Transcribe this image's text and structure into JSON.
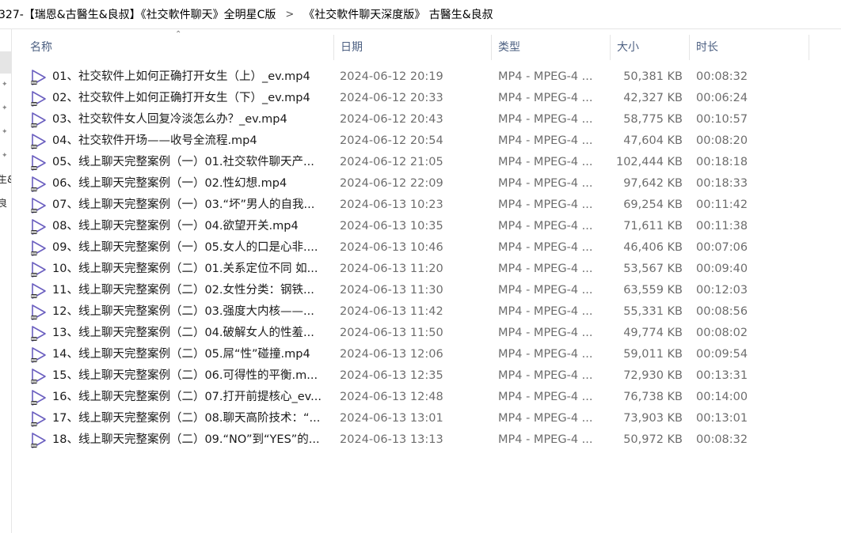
{
  "breadcrumb": {
    "items": [
      "327-【瑞恩&古醫生&良叔】《社交軟件聊天》全明星C版",
      "《社交軟件聊天深度版》 古醫生&良叔"
    ],
    "separator": ">"
  },
  "nav": {
    "fragments": [
      "生&",
      "良"
    ]
  },
  "columns": {
    "name": "名称",
    "date": "日期",
    "type": "类型",
    "size": "大小",
    "duration": "时长"
  },
  "icon_color": "#6b5fc0",
  "files": [
    {
      "name": "01、社交软件上如何正确打开女生（上）_ev.mp4",
      "date": "2024-06-12 20:19",
      "type": "MP4 - MPEG-4 ...",
      "size": "50,381 KB",
      "duration": "00:08:32"
    },
    {
      "name": "02、社交软件上如何正确打开女生（下）_ev.mp4",
      "date": "2024-06-12 20:33",
      "type": "MP4 - MPEG-4 ...",
      "size": "42,327 KB",
      "duration": "00:06:24"
    },
    {
      "name": "03、社交软件女人回复冷淡怎么办？_ev.mp4",
      "date": "2024-06-12 20:43",
      "type": "MP4 - MPEG-4 ...",
      "size": "58,775 KB",
      "duration": "00:10:57"
    },
    {
      "name": "04、社交软件开场——收号全流程.mp4",
      "date": "2024-06-12 20:54",
      "type": "MP4 - MPEG-4 ...",
      "size": "47,604 KB",
      "duration": "00:08:20"
    },
    {
      "name": "05、线上聊天完整案例（一）01.社交软件聊天产...",
      "date": "2024-06-12 21:05",
      "type": "MP4 - MPEG-4 ...",
      "size": "102,444 KB",
      "duration": "00:18:18"
    },
    {
      "name": "06、线上聊天完整案例（一）02.性幻想.mp4",
      "date": "2024-06-12 22:09",
      "type": "MP4 - MPEG-4 ...",
      "size": "97,642 KB",
      "duration": "00:18:33"
    },
    {
      "name": "07、线上聊天完整案例（一）03.“坏”男人的自我...",
      "date": "2024-06-13 10:23",
      "type": "MP4 - MPEG-4 ...",
      "size": "69,254 KB",
      "duration": "00:11:42"
    },
    {
      "name": "08、线上聊天完整案例（一）04.欲望开关.mp4",
      "date": "2024-06-13 10:35",
      "type": "MP4 - MPEG-4 ...",
      "size": "71,611 KB",
      "duration": "00:11:38"
    },
    {
      "name": "09、线上聊天完整案例（一）05.女人的口是心非....",
      "date": "2024-06-13 10:46",
      "type": "MP4 - MPEG-4 ...",
      "size": "46,406 KB",
      "duration": "00:07:06"
    },
    {
      "name": "10、线上聊天完整案例（二）01.关系定位不同 如...",
      "date": "2024-06-13 11:20",
      "type": "MP4 - MPEG-4 ...",
      "size": "53,567 KB",
      "duration": "00:09:40"
    },
    {
      "name": "11、线上聊天完整案例（二）02.女性分类：钢铁...",
      "date": "2024-06-13 11:30",
      "type": "MP4 - MPEG-4 ...",
      "size": "63,559 KB",
      "duration": "00:12:03"
    },
    {
      "name": "12、线上聊天完整案例（二）03.强度大内核——...",
      "date": "2024-06-13 11:42",
      "type": "MP4 - MPEG-4 ...",
      "size": "55,331 KB",
      "duration": "00:08:56"
    },
    {
      "name": "13、线上聊天完整案例（二）04.破解女人的性羞...",
      "date": "2024-06-13 11:50",
      "type": "MP4 - MPEG-4 ...",
      "size": "49,774 KB",
      "duration": "00:08:02"
    },
    {
      "name": "14、线上聊天完整案例（二）05.屌“性”碰撞.mp4",
      "date": "2024-06-13 12:06",
      "type": "MP4 - MPEG-4 ...",
      "size": "59,011 KB",
      "duration": "00:09:54"
    },
    {
      "name": "15、线上聊天完整案例（二）06.可得性的平衡.m...",
      "date": "2024-06-13 12:35",
      "type": "MP4 - MPEG-4 ...",
      "size": "72,930 KB",
      "duration": "00:13:31"
    },
    {
      "name": "16、线上聊天完整案例（二）07.打开前提核心_ev...",
      "date": "2024-06-13 12:48",
      "type": "MP4 - MPEG-4 ...",
      "size": "76,738 KB",
      "duration": "00:14:00"
    },
    {
      "name": "17、线上聊天完整案例（二）08.聊天高阶技术：“...",
      "date": "2024-06-13 13:01",
      "type": "MP4 - MPEG-4 ...",
      "size": "73,903 KB",
      "duration": "00:13:01"
    },
    {
      "name": "18、线上聊天完整案例（二）09.“NO”到“YES”的...",
      "date": "2024-06-13 13:13",
      "type": "MP4 - MPEG-4 ...",
      "size": "50,972 KB",
      "duration": "00:08:32"
    }
  ]
}
